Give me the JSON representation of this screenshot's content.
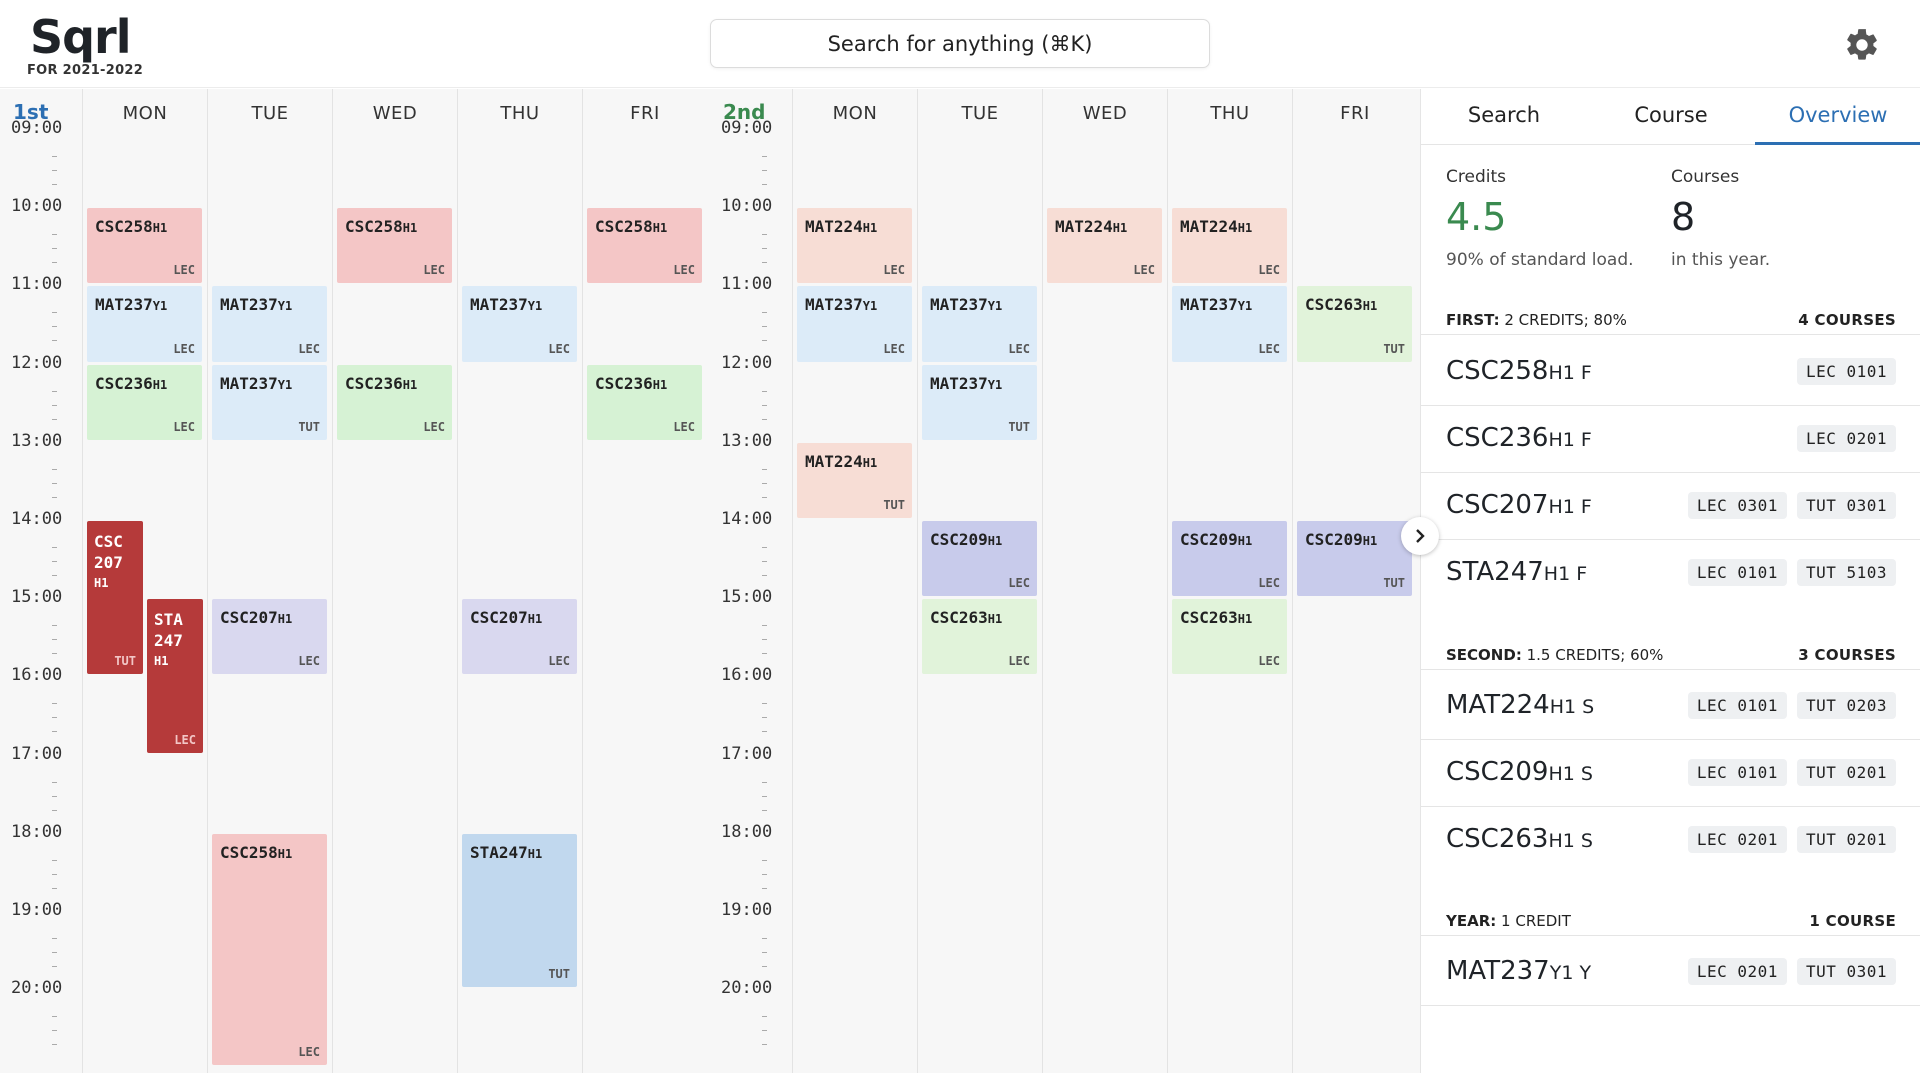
{
  "header": {
    "logo": "Sqrl",
    "subtitle": "FOR 2021-2022",
    "search_placeholder": "Search for anything (⌘K)"
  },
  "calendar": {
    "terms": [
      {
        "label": "1st",
        "color": "#2c6fb3"
      },
      {
        "label": "2nd",
        "color": "#3a8a4f"
      }
    ],
    "times": [
      "09:00",
      "10:00",
      "11:00",
      "12:00",
      "13:00",
      "14:00",
      "15:00",
      "16:00",
      "17:00",
      "18:00",
      "19:00",
      "20:00"
    ],
    "days": [
      "MON",
      "TUE",
      "WED",
      "THU",
      "FRI"
    ],
    "term1_events": [
      {
        "code": "CSC258",
        "suffix": "H1",
        "type": "LEC",
        "day": 0,
        "start": 10,
        "end": 11,
        "color": "red"
      },
      {
        "code": "MAT237",
        "suffix": "Y1",
        "type": "LEC",
        "day": 0,
        "start": 11,
        "end": 12,
        "color": "blue"
      },
      {
        "code": "CSC236",
        "suffix": "H1",
        "type": "LEC",
        "day": 0,
        "start": 12,
        "end": 13,
        "color": "green"
      },
      {
        "code": "MAT237",
        "suffix": "Y1",
        "type": "LEC",
        "day": 1,
        "start": 11,
        "end": 12,
        "color": "blue"
      },
      {
        "code": "MAT237",
        "suffix": "Y1",
        "type": "TUT",
        "day": 1,
        "start": 12,
        "end": 13,
        "color": "blue"
      },
      {
        "code": "CSC207",
        "suffix": "H1",
        "type": "LEC",
        "day": 1,
        "start": 15,
        "end": 16,
        "color": "lav"
      },
      {
        "code": "CSC258",
        "suffix": "H1",
        "type": "LEC",
        "day": 1,
        "start": 18,
        "end": 21,
        "color": "red"
      },
      {
        "code": "CSC258",
        "suffix": "H1",
        "type": "LEC",
        "day": 2,
        "start": 10,
        "end": 11,
        "color": "red"
      },
      {
        "code": "CSC236",
        "suffix": "H1",
        "type": "LEC",
        "day": 2,
        "start": 12,
        "end": 13,
        "color": "green"
      },
      {
        "code": "MAT237",
        "suffix": "Y1",
        "type": "LEC",
        "day": 3,
        "start": 11,
        "end": 12,
        "color": "blue"
      },
      {
        "code": "CSC207",
        "suffix": "H1",
        "type": "LEC",
        "day": 3,
        "start": 15,
        "end": 16,
        "color": "lav"
      },
      {
        "code": "STA247",
        "suffix": "H1",
        "type": "TUT",
        "day": 3,
        "start": 18,
        "end": 20,
        "color": "sky"
      },
      {
        "code": "CSC258",
        "suffix": "H1",
        "type": "LEC",
        "day": 4,
        "start": 10,
        "end": 11,
        "color": "red"
      },
      {
        "code": "CSC236",
        "suffix": "H1",
        "type": "LEC",
        "day": 4,
        "start": 12,
        "end": 13,
        "color": "green"
      }
    ],
    "term1_conflicts": [
      {
        "line1": "CSC",
        "line2": "207",
        "line3": "H1",
        "type": "TUT",
        "day": 0,
        "start": 14,
        "end": 16,
        "slot": 0
      },
      {
        "line1": "STA",
        "line2": "247",
        "line3": "H1",
        "type": "LEC",
        "day": 0,
        "start": 15,
        "end": 17,
        "slot": 1
      }
    ],
    "term2_events": [
      {
        "code": "MAT224",
        "suffix": "H1",
        "type": "LEC",
        "day": 0,
        "start": 10,
        "end": 11,
        "color": "peach"
      },
      {
        "code": "MAT237",
        "suffix": "Y1",
        "type": "LEC",
        "day": 0,
        "start": 11,
        "end": 12,
        "color": "blue"
      },
      {
        "code": "MAT224",
        "suffix": "H1",
        "type": "TUT",
        "day": 0,
        "start": 13,
        "end": 14,
        "color": "peach"
      },
      {
        "code": "MAT237",
        "suffix": "Y1",
        "type": "LEC",
        "day": 1,
        "start": 11,
        "end": 12,
        "color": "blue"
      },
      {
        "code": "MAT237",
        "suffix": "Y1",
        "type": "TUT",
        "day": 1,
        "start": 12,
        "end": 13,
        "color": "blue"
      },
      {
        "code": "CSC209",
        "suffix": "H1",
        "type": "LEC",
        "day": 1,
        "start": 14,
        "end": 15,
        "color": "periw"
      },
      {
        "code": "CSC263",
        "suffix": "H1",
        "type": "LEC",
        "day": 1,
        "start": 15,
        "end": 16,
        "color": "mint"
      },
      {
        "code": "MAT224",
        "suffix": "H1",
        "type": "LEC",
        "day": 2,
        "start": 10,
        "end": 11,
        "color": "peach"
      },
      {
        "code": "MAT224",
        "suffix": "H1",
        "type": "LEC",
        "day": 3,
        "start": 10,
        "end": 11,
        "color": "peach"
      },
      {
        "code": "MAT237",
        "suffix": "Y1",
        "type": "LEC",
        "day": 3,
        "start": 11,
        "end": 12,
        "color": "blue"
      },
      {
        "code": "CSC209",
        "suffix": "H1",
        "type": "LEC",
        "day": 3,
        "start": 14,
        "end": 15,
        "color": "periw"
      },
      {
        "code": "CSC263",
        "suffix": "H1",
        "type": "LEC",
        "day": 3,
        "start": 15,
        "end": 16,
        "color": "mint"
      },
      {
        "code": "CSC263",
        "suffix": "H1",
        "type": "TUT",
        "day": 4,
        "start": 11,
        "end": 12,
        "color": "mint"
      },
      {
        "code": "CSC209",
        "suffix": "H1",
        "type": "TUT",
        "day": 4,
        "start": 14,
        "end": 15,
        "color": "periw"
      }
    ]
  },
  "sidebar": {
    "tabs": [
      "Search",
      "Course",
      "Overview"
    ],
    "active_tab": "Overview",
    "credits_label": "Credits",
    "credits_value": "4.5",
    "credits_sub": "90% of standard load.",
    "courses_label": "Courses",
    "courses_value": "8",
    "courses_sub": "in this year.",
    "sections": [
      {
        "name": "FIRST:",
        "detail": "2 CREDITS; 80%",
        "count": "4 COURSES",
        "courses": [
          {
            "code": "CSC258",
            "suffix": "H1 F",
            "meetings": [
              "LEC 0101"
            ]
          },
          {
            "code": "CSC236",
            "suffix": "H1 F",
            "meetings": [
              "LEC 0201"
            ]
          },
          {
            "code": "CSC207",
            "suffix": "H1 F",
            "meetings": [
              "LEC 0301",
              "TUT 0301"
            ]
          },
          {
            "code": "STA247",
            "suffix": "H1 F",
            "meetings": [
              "LEC 0101",
              "TUT 5103"
            ]
          }
        ]
      },
      {
        "name": "SECOND:",
        "detail": "1.5 CREDITS; 60%",
        "count": "3 COURSES",
        "courses": [
          {
            "code": "MAT224",
            "suffix": "H1 S",
            "meetings": [
              "LEC 0101",
              "TUT 0203"
            ]
          },
          {
            "code": "CSC209",
            "suffix": "H1 S",
            "meetings": [
              "LEC 0101",
              "TUT 0201"
            ]
          },
          {
            "code": "CSC263",
            "suffix": "H1 S",
            "meetings": [
              "LEC 0201",
              "TUT 0201"
            ]
          }
        ]
      },
      {
        "name": "YEAR:",
        "detail": "1 CREDIT",
        "count": "1 COURSE",
        "courses": [
          {
            "code": "MAT237",
            "suffix": "Y1 Y",
            "meetings": [
              "LEC 0201",
              "TUT 0301"
            ]
          }
        ]
      }
    ]
  },
  "colors": {
    "accent": "#2c6fb3",
    "credits_green": "#3a8a4f",
    "conflict_red": "#b53a3a"
  }
}
